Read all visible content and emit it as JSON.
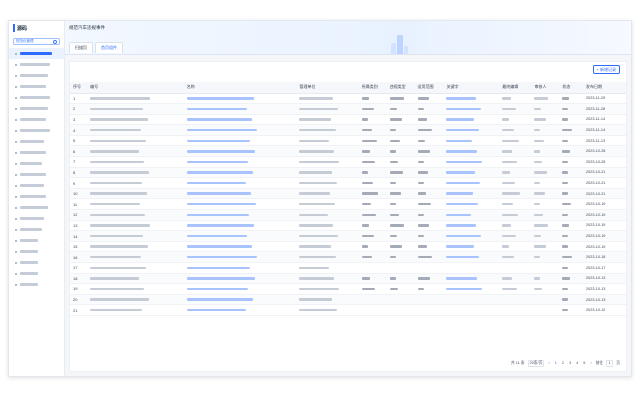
{
  "sidebar": {
    "brand": "源码",
    "search_text": "规范化管理",
    "items_count": 22
  },
  "banner": {
    "title": "规范汽车违规事件"
  },
  "tabs": [
    {
      "label": "扫描页"
    },
    {
      "label": "首页组件"
    }
  ],
  "toolbar": {
    "add_label": "新增记录"
  },
  "table": {
    "headers": [
      "序号",
      "编号",
      "名称",
      "管理单位",
      "所属类别",
      "违规类型",
      "适用范围",
      "关键字",
      "最终编辑",
      "审核人",
      "状态",
      "发布日期"
    ],
    "rows": [
      {
        "index": "1",
        "date": "2023-11-29"
      },
      {
        "index": "2",
        "date": "2023-11-28"
      },
      {
        "index": "3",
        "date": "2023-11-14"
      },
      {
        "index": "4",
        "date": "2023-11-14"
      },
      {
        "index": "5",
        "date": "2023-11-13"
      },
      {
        "index": "6",
        "date": "2023-10-26"
      },
      {
        "index": "7",
        "date": "2023-10-25"
      },
      {
        "index": "8",
        "date": "2023-10-21"
      },
      {
        "index": "9",
        "date": "2023-10-21"
      },
      {
        "index": "10",
        "date": "2023-10-21"
      },
      {
        "index": "11",
        "date": "2023-10-19"
      },
      {
        "index": "12",
        "date": "2023-10-19"
      },
      {
        "index": "13",
        "date": "2023-10-19"
      },
      {
        "index": "14",
        "date": "2023-10-19"
      },
      {
        "index": "15",
        "date": "2023-10-19"
      },
      {
        "index": "16",
        "date": "2023-10-18"
      },
      {
        "index": "17",
        "date": "2023-10-17"
      },
      {
        "index": "18",
        "date": "2023-10-13"
      },
      {
        "index": "19",
        "date": "2023-10-13"
      },
      {
        "index": "20",
        "date": "2023-10-13"
      },
      {
        "index": "21",
        "date": "2023-10-12"
      }
    ]
  },
  "pagination": {
    "total": "共 11 条",
    "page_size": "20条/页",
    "pages": [
      "1",
      "2",
      "3",
      "4",
      "5"
    ],
    "current": "1",
    "jump_label": "前往",
    "jump_value": "1",
    "page_unit": "页"
  }
}
